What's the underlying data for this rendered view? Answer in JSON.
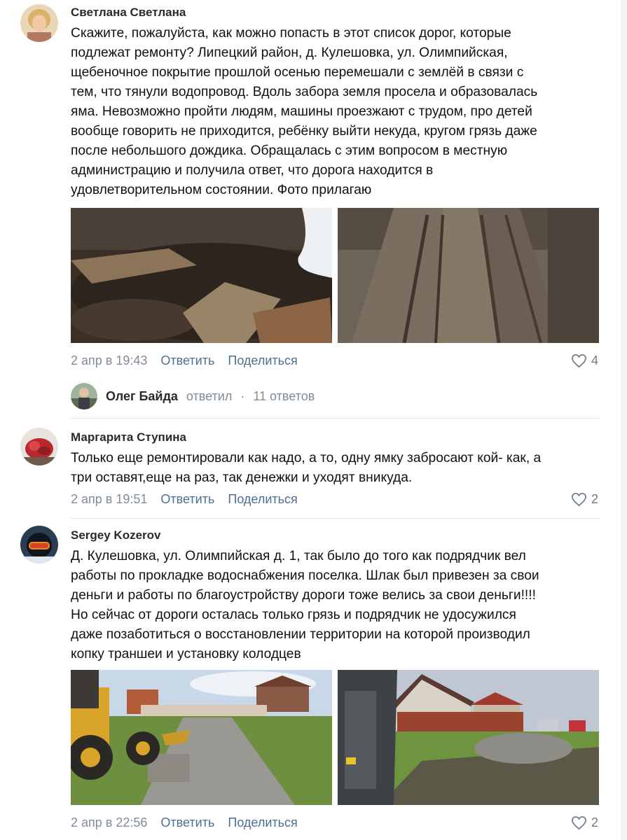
{
  "comments": [
    {
      "author": "Светлана Светлана",
      "lines": [
        "Скажите, пожалуйста, как можно попасть в этот список дорог, которые",
        "подлежат ремонту? Липецкий район, д. Кулешовка, ул. Олимпийская,",
        "щебеночное покрытие прошлой осенью перемешали с землёй в связи с",
        "тем, что тянули водопровод. Вдоль забора земля просела и образовалась",
        "яма. Невозможно пройти людям, машины проезжают с трудом, про детей",
        "вообще говорить не приходится, ребёнку выйти некуда, кругом грязь даже",
        "после небольшого дождика. Обращалась с этим вопросом в местную",
        "администрацию и получила ответ, что дорога находится в",
        "удовлетворительном состоянии. Фото прилагаю"
      ],
      "date": "2 апр в 19:43",
      "reply_label": "Ответить",
      "share_label": "Поделиться",
      "likes": "4",
      "thread": {
        "name": "Олег Байда",
        "action": "ответил",
        "separator": "·",
        "count": "11 ответов"
      }
    },
    {
      "author": "Маргарита Ступина",
      "lines": [
        "Только еще ремонтировали как надо, а то, одну ямку забросают кой- как, а",
        "три оставят,еще на раз, так денежки и уходят вникуда."
      ],
      "date": "2 апр в 19:51",
      "reply_label": "Ответить",
      "share_label": "Поделиться",
      "likes": "2"
    },
    {
      "author": "Sergey Kozerov",
      "lines": [
        "Д. Кулешовка, ул. Олимпийская д. 1, так было до того как подрядчик вел",
        "работы по прокладке водоснабжения поселка. Шлак был привезен за свои",
        "деньги и работы по благоустройству дороги тоже велись за свои деньги!!!!",
        "Но сейчас от дороги осталась только грязь и подрядчик не удосужился",
        "даже позаботиться о восстановлении территории на которой производил",
        "копку траншеи и установку колодцев"
      ],
      "date": "2 апр в 22:56",
      "reply_label": "Ответить",
      "share_label": "Поделиться",
      "likes": "2"
    }
  ],
  "icons": {
    "like": "heart-outline-icon"
  },
  "colors": {
    "link": "#4c6f94",
    "meta": "#818c99",
    "divider": "#e1e3e6"
  }
}
